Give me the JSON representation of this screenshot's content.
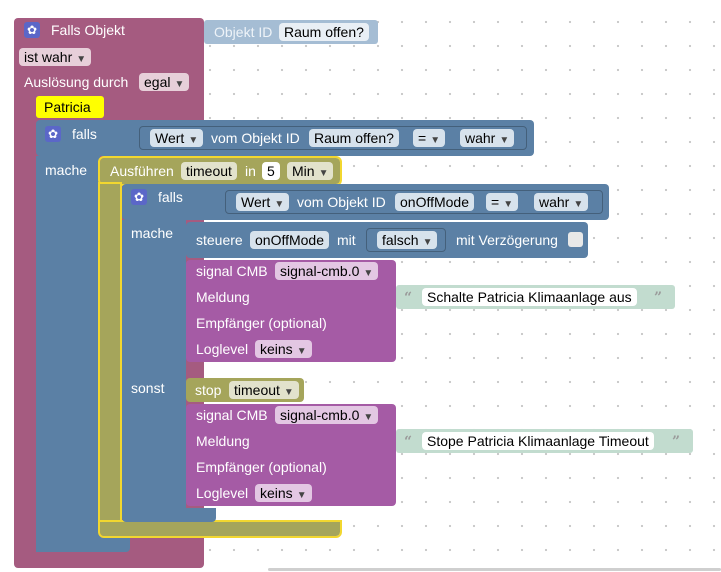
{
  "trigger": {
    "title": "Falls Objekt",
    "object_id_label": "Objekt ID",
    "object_id_value": "Raum offen?",
    "condition_value": "ist wahr",
    "triggered_by_label": "Auslösung durch",
    "triggered_by_value": "egal"
  },
  "comment": {
    "text": "Patricia"
  },
  "outer_if": {
    "if_label": "falls",
    "do_label": "mache",
    "value_field": "Wert",
    "of_object_label": "vom Objekt ID",
    "object_value": "Raum offen?",
    "operator": "=",
    "compare_value": "wahr"
  },
  "timeout": {
    "run_label": "Ausführen",
    "name": "timeout",
    "in_label": "in",
    "amount": "5",
    "unit": "Min"
  },
  "inner_if": {
    "if_label": "falls",
    "do_label": "mache",
    "else_label": "sonst",
    "value_field": "Wert",
    "of_object_label": "vom Objekt ID",
    "object_value": "onOffMode",
    "operator": "=",
    "compare_value": "wahr"
  },
  "control": {
    "label": "steuere",
    "target": "onOffMode",
    "with_label": "mit",
    "value": "falsch",
    "delay_label": "mit Verzögerung"
  },
  "signal1": {
    "label": "signal CMB",
    "instance": "signal-cmb.0",
    "message_label": "Meldung",
    "message_text": "Schalte Patricia Klimaanlage aus",
    "recipient_label": "Empfänger (optional)",
    "loglevel_label": "Loglevel",
    "loglevel_value": "keins"
  },
  "stop": {
    "label": "stop",
    "name": "timeout"
  },
  "signal2": {
    "label": "signal CMB",
    "instance": "signal-cmb.0",
    "message_label": "Meldung",
    "message_text": "Stope Patricia Klimaanlage Timeout",
    "recipient_label": "Empfänger (optional)",
    "loglevel_label": "Loglevel",
    "loglevel_value": "keins"
  },
  "colors": {
    "trigger": "#a55b80",
    "logic": "#5b80a5",
    "timeout": "#a5a55b",
    "signal": "#a55ba5",
    "comment": "#ffff00",
    "highlight": "#f2d72f"
  }
}
